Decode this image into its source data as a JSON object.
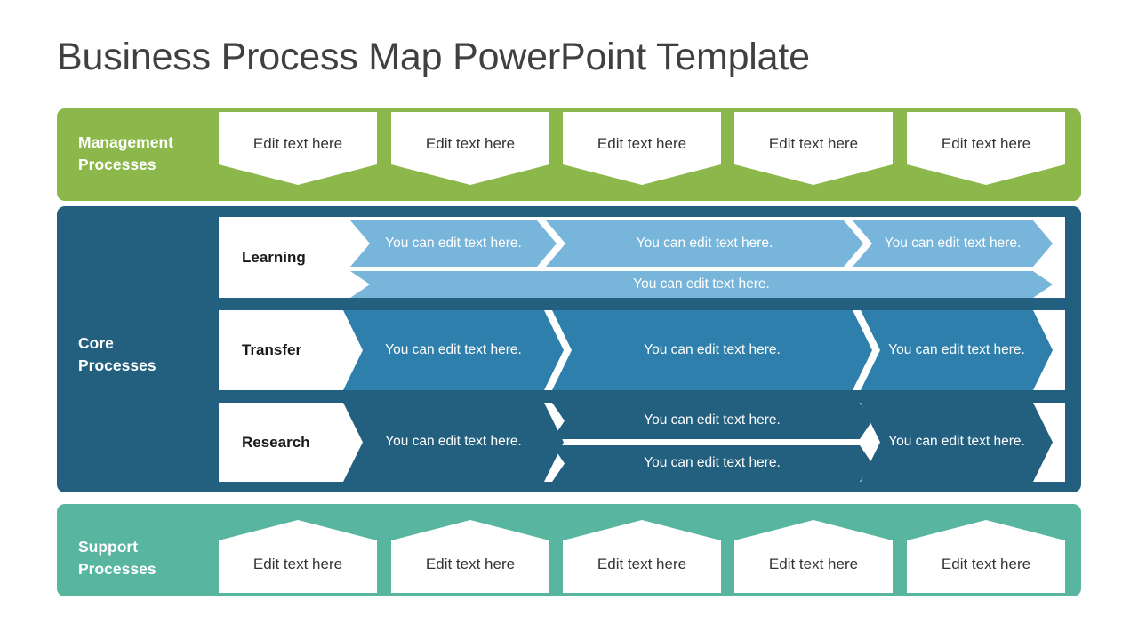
{
  "title": "Business Process Map PowerPoint Template",
  "colors": {
    "management_green": "#8cb84b",
    "support_teal": "#57b5a0",
    "core_dark_blue": "#23607f",
    "learning_light_blue": "#77b5da",
    "transfer_mid_blue": "#2e7fab",
    "research_dark_blue": "#23607f",
    "title_text": "#404040"
  },
  "bands": {
    "management": {
      "label": "Management\nProcesses",
      "boxes": [
        {
          "text": "Edit text here"
        },
        {
          "text": "Edit text here"
        },
        {
          "text": "Edit text here"
        },
        {
          "text": "Edit text here"
        },
        {
          "text": "Edit text here"
        }
      ]
    },
    "core": {
      "label": "Core\nProcesses",
      "rows": [
        {
          "label": "Learning",
          "top_chevrons": [
            {
              "text": "You can edit text here."
            },
            {
              "text": "You can edit text here."
            },
            {
              "text": "You can edit text here."
            }
          ],
          "bottom_chevrons": [
            {
              "text": "You can edit text here."
            }
          ]
        },
        {
          "label": "Transfer",
          "chevrons": [
            {
              "text": "You can edit text here."
            },
            {
              "text": "You can edit text here."
            },
            {
              "text": "You can edit text here."
            }
          ]
        },
        {
          "label": "Research",
          "first_chevron": {
            "text": "You can edit text here."
          },
          "middle_stack": [
            {
              "text": "You can edit text here."
            },
            {
              "text": "You can edit text here."
            }
          ],
          "last_chevron": {
            "text": "You can edit text here."
          }
        }
      ]
    },
    "support": {
      "label": "Support\nProcesses",
      "boxes": [
        {
          "text": "Edit text here"
        },
        {
          "text": "Edit text here"
        },
        {
          "text": "Edit text here"
        },
        {
          "text": "Edit text here"
        },
        {
          "text": "Edit text here"
        }
      ]
    }
  }
}
